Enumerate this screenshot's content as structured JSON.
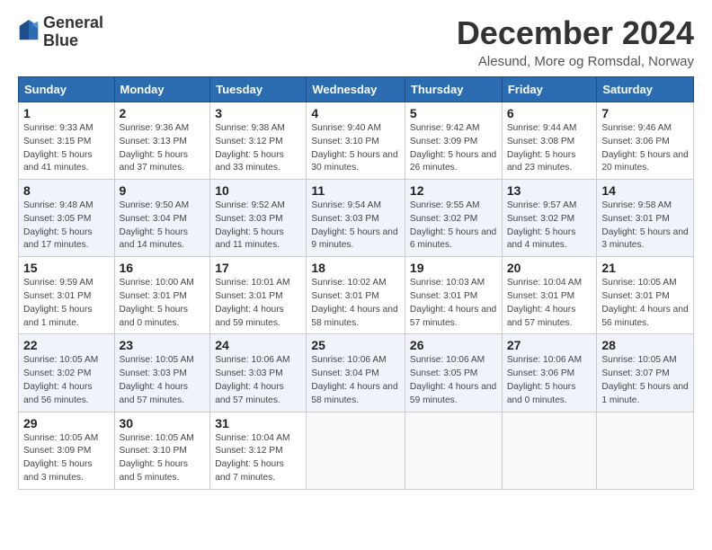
{
  "header": {
    "logo_line1": "General",
    "logo_line2": "Blue",
    "month": "December 2024",
    "location": "Alesund, More og Romsdal, Norway"
  },
  "weekdays": [
    "Sunday",
    "Monday",
    "Tuesday",
    "Wednesday",
    "Thursday",
    "Friday",
    "Saturday"
  ],
  "weeks": [
    [
      {
        "day": 1,
        "sunrise": "Sunrise: 9:33 AM",
        "sunset": "Sunset: 3:15 PM",
        "daylight": "Daylight: 5 hours and 41 minutes."
      },
      {
        "day": 2,
        "sunrise": "Sunrise: 9:36 AM",
        "sunset": "Sunset: 3:13 PM",
        "daylight": "Daylight: 5 hours and 37 minutes."
      },
      {
        "day": 3,
        "sunrise": "Sunrise: 9:38 AM",
        "sunset": "Sunset: 3:12 PM",
        "daylight": "Daylight: 5 hours and 33 minutes."
      },
      {
        "day": 4,
        "sunrise": "Sunrise: 9:40 AM",
        "sunset": "Sunset: 3:10 PM",
        "daylight": "Daylight: 5 hours and 30 minutes."
      },
      {
        "day": 5,
        "sunrise": "Sunrise: 9:42 AM",
        "sunset": "Sunset: 3:09 PM",
        "daylight": "Daylight: 5 hours and 26 minutes."
      },
      {
        "day": 6,
        "sunrise": "Sunrise: 9:44 AM",
        "sunset": "Sunset: 3:08 PM",
        "daylight": "Daylight: 5 hours and 23 minutes."
      },
      {
        "day": 7,
        "sunrise": "Sunrise: 9:46 AM",
        "sunset": "Sunset: 3:06 PM",
        "daylight": "Daylight: 5 hours and 20 minutes."
      }
    ],
    [
      {
        "day": 8,
        "sunrise": "Sunrise: 9:48 AM",
        "sunset": "Sunset: 3:05 PM",
        "daylight": "Daylight: 5 hours and 17 minutes."
      },
      {
        "day": 9,
        "sunrise": "Sunrise: 9:50 AM",
        "sunset": "Sunset: 3:04 PM",
        "daylight": "Daylight: 5 hours and 14 minutes."
      },
      {
        "day": 10,
        "sunrise": "Sunrise: 9:52 AM",
        "sunset": "Sunset: 3:03 PM",
        "daylight": "Daylight: 5 hours and 11 minutes."
      },
      {
        "day": 11,
        "sunrise": "Sunrise: 9:54 AM",
        "sunset": "Sunset: 3:03 PM",
        "daylight": "Daylight: 5 hours and 9 minutes."
      },
      {
        "day": 12,
        "sunrise": "Sunrise: 9:55 AM",
        "sunset": "Sunset: 3:02 PM",
        "daylight": "Daylight: 5 hours and 6 minutes."
      },
      {
        "day": 13,
        "sunrise": "Sunrise: 9:57 AM",
        "sunset": "Sunset: 3:02 PM",
        "daylight": "Daylight: 5 hours and 4 minutes."
      },
      {
        "day": 14,
        "sunrise": "Sunrise: 9:58 AM",
        "sunset": "Sunset: 3:01 PM",
        "daylight": "Daylight: 5 hours and 3 minutes."
      }
    ],
    [
      {
        "day": 15,
        "sunrise": "Sunrise: 9:59 AM",
        "sunset": "Sunset: 3:01 PM",
        "daylight": "Daylight: 5 hours and 1 minute."
      },
      {
        "day": 16,
        "sunrise": "Sunrise: 10:00 AM",
        "sunset": "Sunset: 3:01 PM",
        "daylight": "Daylight: 5 hours and 0 minutes."
      },
      {
        "day": 17,
        "sunrise": "Sunrise: 10:01 AM",
        "sunset": "Sunset: 3:01 PM",
        "daylight": "Daylight: 4 hours and 59 minutes."
      },
      {
        "day": 18,
        "sunrise": "Sunrise: 10:02 AM",
        "sunset": "Sunset: 3:01 PM",
        "daylight": "Daylight: 4 hours and 58 minutes."
      },
      {
        "day": 19,
        "sunrise": "Sunrise: 10:03 AM",
        "sunset": "Sunset: 3:01 PM",
        "daylight": "Daylight: 4 hours and 57 minutes."
      },
      {
        "day": 20,
        "sunrise": "Sunrise: 10:04 AM",
        "sunset": "Sunset: 3:01 PM",
        "daylight": "Daylight: 4 hours and 57 minutes."
      },
      {
        "day": 21,
        "sunrise": "Sunrise: 10:05 AM",
        "sunset": "Sunset: 3:01 PM",
        "daylight": "Daylight: 4 hours and 56 minutes."
      }
    ],
    [
      {
        "day": 22,
        "sunrise": "Sunrise: 10:05 AM",
        "sunset": "Sunset: 3:02 PM",
        "daylight": "Daylight: 4 hours and 56 minutes."
      },
      {
        "day": 23,
        "sunrise": "Sunrise: 10:05 AM",
        "sunset": "Sunset: 3:03 PM",
        "daylight": "Daylight: 4 hours and 57 minutes."
      },
      {
        "day": 24,
        "sunrise": "Sunrise: 10:06 AM",
        "sunset": "Sunset: 3:03 PM",
        "daylight": "Daylight: 4 hours and 57 minutes."
      },
      {
        "day": 25,
        "sunrise": "Sunrise: 10:06 AM",
        "sunset": "Sunset: 3:04 PM",
        "daylight": "Daylight: 4 hours and 58 minutes."
      },
      {
        "day": 26,
        "sunrise": "Sunrise: 10:06 AM",
        "sunset": "Sunset: 3:05 PM",
        "daylight": "Daylight: 4 hours and 59 minutes."
      },
      {
        "day": 27,
        "sunrise": "Sunrise: 10:06 AM",
        "sunset": "Sunset: 3:06 PM",
        "daylight": "Daylight: 5 hours and 0 minutes."
      },
      {
        "day": 28,
        "sunrise": "Sunrise: 10:05 AM",
        "sunset": "Sunset: 3:07 PM",
        "daylight": "Daylight: 5 hours and 1 minute."
      }
    ],
    [
      {
        "day": 29,
        "sunrise": "Sunrise: 10:05 AM",
        "sunset": "Sunset: 3:09 PM",
        "daylight": "Daylight: 5 hours and 3 minutes."
      },
      {
        "day": 30,
        "sunrise": "Sunrise: 10:05 AM",
        "sunset": "Sunset: 3:10 PM",
        "daylight": "Daylight: 5 hours and 5 minutes."
      },
      {
        "day": 31,
        "sunrise": "Sunrise: 10:04 AM",
        "sunset": "Sunset: 3:12 PM",
        "daylight": "Daylight: 5 hours and 7 minutes."
      },
      null,
      null,
      null,
      null
    ]
  ]
}
